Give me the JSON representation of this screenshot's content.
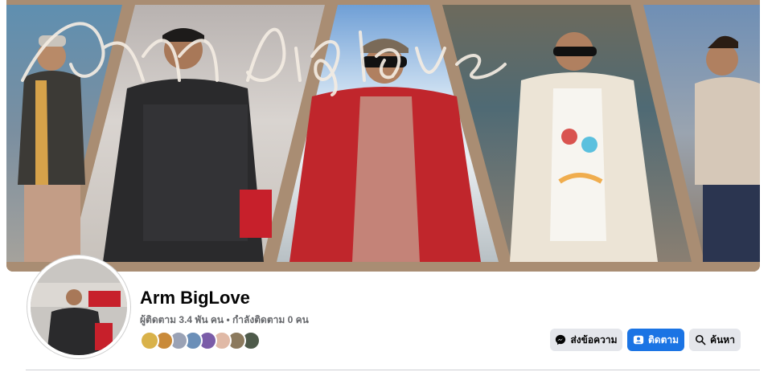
{
  "profile": {
    "name": "Arm BigLove",
    "followers_label": "ผู้ติดตาม",
    "followers_count": "3.4 พัน",
    "followers_unit": "คน",
    "separator": "•",
    "following_label": "กำลังติดตาม",
    "following_count": "0",
    "following_unit": "คน",
    "cover_script_text": "Arm biglove"
  },
  "actions": {
    "message_label": "ส่งข้อความ",
    "follow_label": "ติดตาม",
    "search_label": "ค้นหา"
  },
  "follower_avatars": [
    {
      "color": "#d9b24a"
    },
    {
      "color": "#c98a3a"
    },
    {
      "color": "#9aa2b5"
    },
    {
      "color": "#6b8fb8"
    },
    {
      "color": "#7a5ca8"
    },
    {
      "color": "#e0b9a6"
    },
    {
      "color": "#8c7a5e"
    },
    {
      "color": "#4e5a4a"
    }
  ],
  "icons": {
    "message": "messenger-icon",
    "follow": "follow-icon",
    "search": "search-icon"
  },
  "colors": {
    "accent": "#1b74e4",
    "secondary_button": "#e4e6eb",
    "text_primary": "#050505",
    "text_secondary": "#65676b",
    "cover_frame": "#a98d73"
  }
}
